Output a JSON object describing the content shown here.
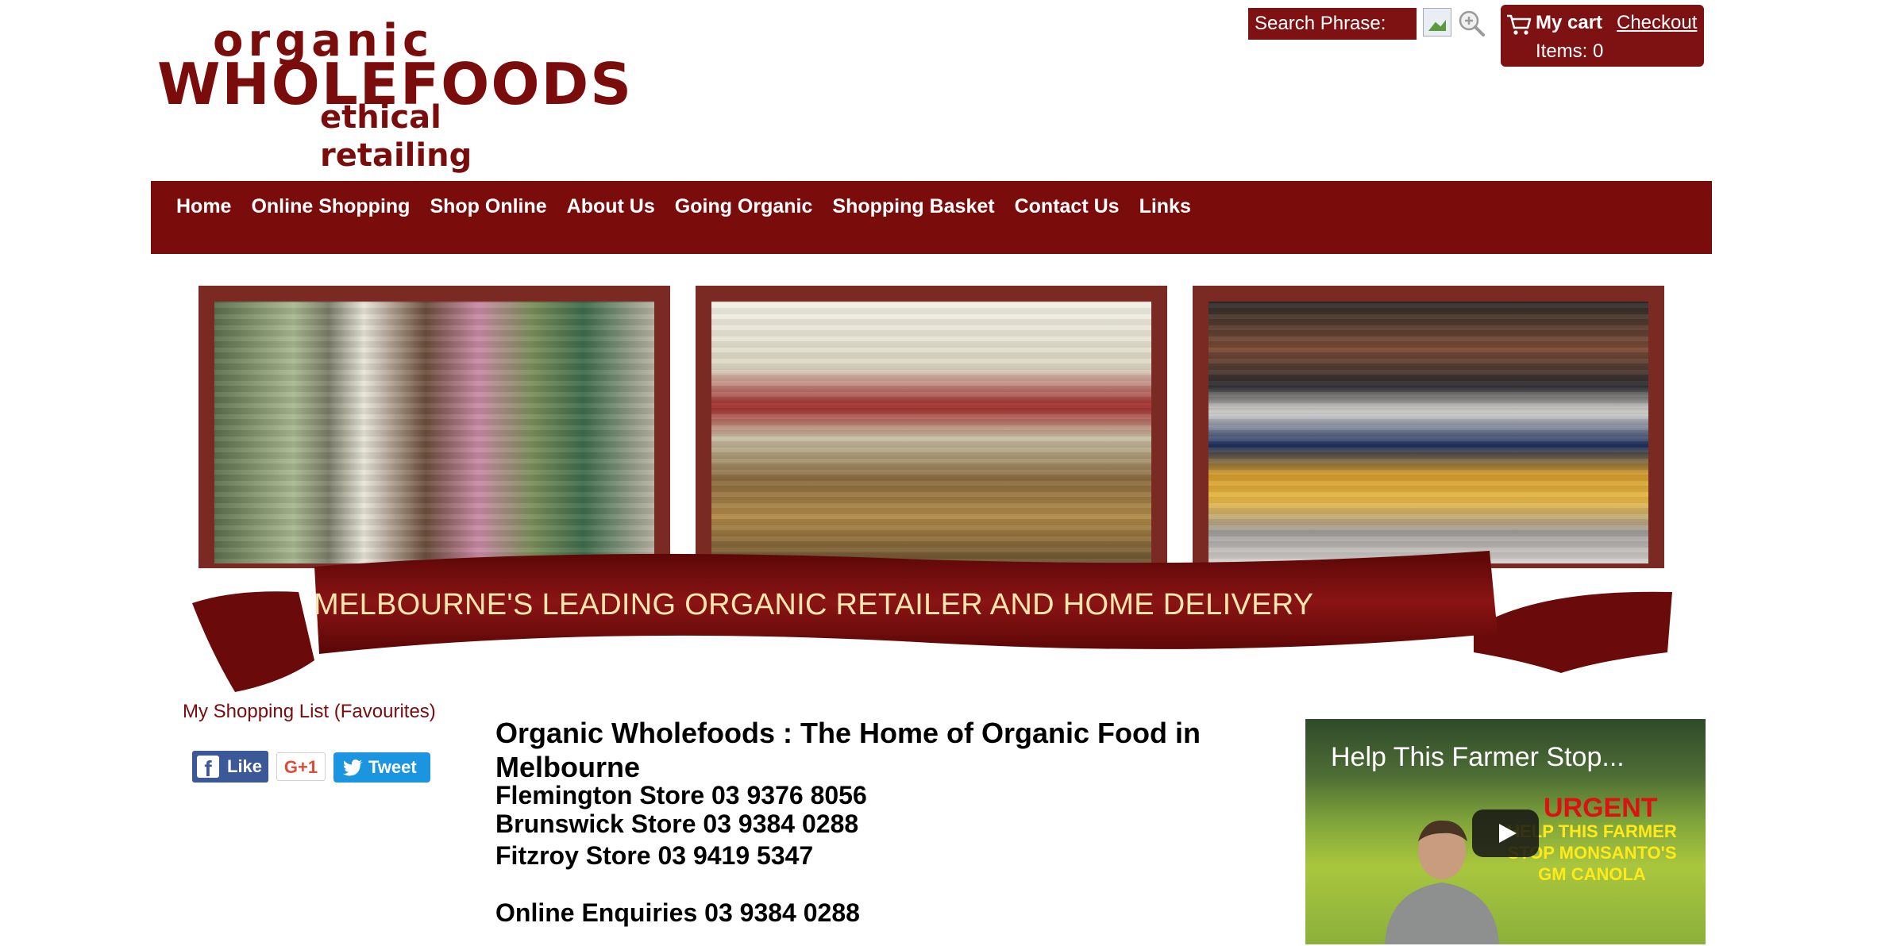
{
  "logo": {
    "line1": "organic",
    "line2": "WHOLEFOODS",
    "line3": "ethical retailing"
  },
  "search": {
    "label": "Search Phrase:"
  },
  "cart": {
    "title": "My cart",
    "checkout": "Checkout",
    "items": "Items: 0"
  },
  "nav": {
    "items": [
      "Home",
      "Online Shopping",
      "Shop Online",
      "About Us",
      "Going Organic",
      "Shopping Basket",
      "Contact Us",
      "Links"
    ]
  },
  "banner": {
    "text": "MELBOURNE'S LEADING ORGANIC RETAILER AND HOME DELIVERY"
  },
  "sidebar": {
    "favourites_link": "My Shopping List (Favourites)",
    "like_label": "Like",
    "gplus_label": "G+1",
    "tweet_label": "Tweet"
  },
  "main": {
    "title": "Organic Wholefoods : The Home of Organic Food in Melbourne",
    "stores": [
      "Flemington Store 03 9376 8056",
      "Brunswick Store 03 9384 0288",
      "Fitzroy Store 03 9419 5347"
    ],
    "enquiries": "Online Enquiries 03 9384 0288"
  },
  "video": {
    "title": "Help This Farmer Stop...",
    "urgent": "URGENT",
    "caption": "HELP THIS FARMER STOP MONSANTO'S GM CANOLA"
  },
  "colors": {
    "brand": "#7a0c0c",
    "banner_text": "#f7e6b0"
  }
}
